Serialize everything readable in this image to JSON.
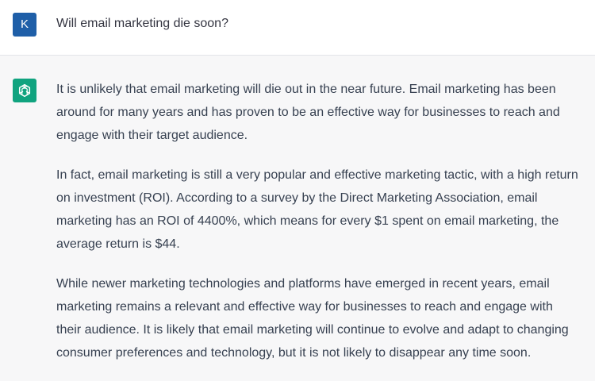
{
  "user": {
    "avatar_letter": "K",
    "message": "Will email marketing die soon?"
  },
  "assistant": {
    "avatar_icon": "openai-logo-icon",
    "paragraphs": [
      "It is unlikely that email marketing will die out in the near future. Email marketing has been around for many years and has proven to be an effective way for businesses to reach and engage with their target audience.",
      "In fact, email marketing is still a very popular and effective marketing tactic, with a high return on investment (ROI). According to a survey by the Direct Marketing Association, email marketing has an ROI of 4400%, which means for every $1 spent on email marketing, the average return is $44.",
      "While newer marketing technologies and platforms have emerged in recent years, email marketing remains a relevant and effective way for businesses to reach and engage with their audience. It is likely that email marketing will continue to evolve and adapt to changing consumer preferences and technology, but it is not likely to disappear any time soon."
    ]
  },
  "colors": {
    "user_avatar_bg": "#1f5fa8",
    "assistant_avatar_bg": "#10a37f",
    "assistant_row_bg": "#f7f7f8",
    "text": "#374151"
  }
}
